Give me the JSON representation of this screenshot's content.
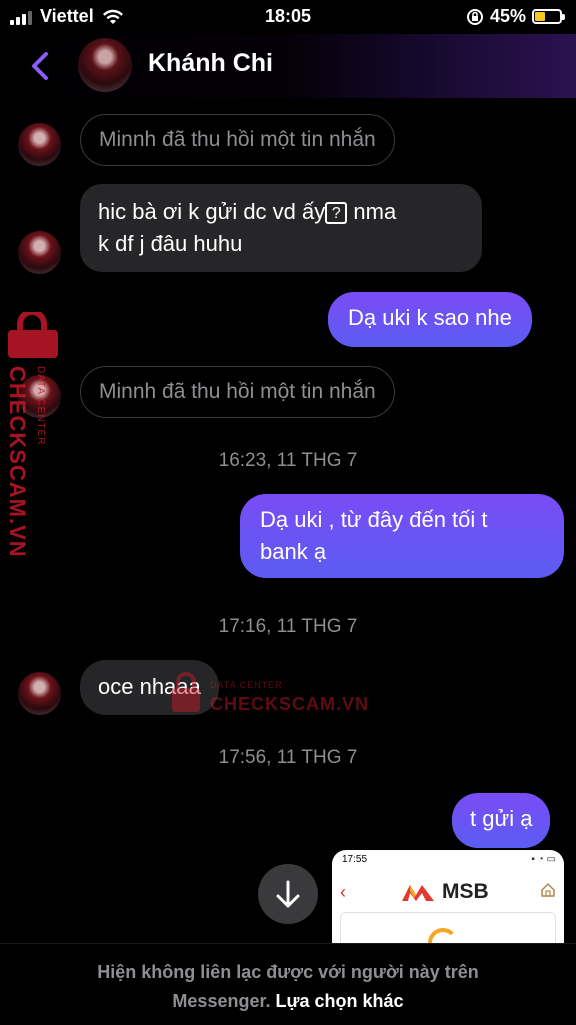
{
  "status": {
    "carrier": "Viettel",
    "time": "18:05",
    "battery_percent": "45%",
    "battery_level": 0.45
  },
  "header": {
    "contact_name": "Khánh Chi"
  },
  "messages": {
    "m1_unsent": "Minnh đã thu hồi một tin nhắn",
    "m2_line1_a": "hic bà ơi k gửi dc vd ấy",
    "m2_unknown_glyph": "?",
    "m2_line1_b": " nma",
    "m2_line2": "k df j đâu huhu",
    "m3_out": "Dạ uki k sao nhe",
    "m4_unsent": "Minnh đã thu hồi một tin nhắn",
    "ts1": "16:23, 11 THG 7",
    "m5_out_line1": "Dạ uki , từ đây đến tối t",
    "m5_out_line2": "bank ạ",
    "ts2": "17:16, 11 THG 7",
    "m6_in": "oce nhaaa",
    "ts3": "17:56, 11 THG 7",
    "m7_out": "t gửi ạ"
  },
  "preview": {
    "time": "17:55",
    "bank_logo_text": "MSB"
  },
  "watermark": {
    "vertical_text": "CHECKSCAM.VN",
    "vertical_sub": "DATA CENTER",
    "center_text": "CHECKSCAM.VN",
    "center_sub": "DATA CENTER"
  },
  "footer": {
    "notice": "Hiện không liên lạc được với người này trên Messenger.",
    "notice_line1": "Hiện không liên lạc được với người này trên",
    "notice_line2": "Messenger.",
    "option_link": "Lựa chọn khác"
  },
  "colors": {
    "accent_purple": "#7a4cf6",
    "outgoing_bottom": "#5b5cf2",
    "incoming_bg": "#262628",
    "muted_text": "#8e8e93",
    "watermark_red": "#d0192c",
    "battery_yellow": "#f6c623"
  }
}
